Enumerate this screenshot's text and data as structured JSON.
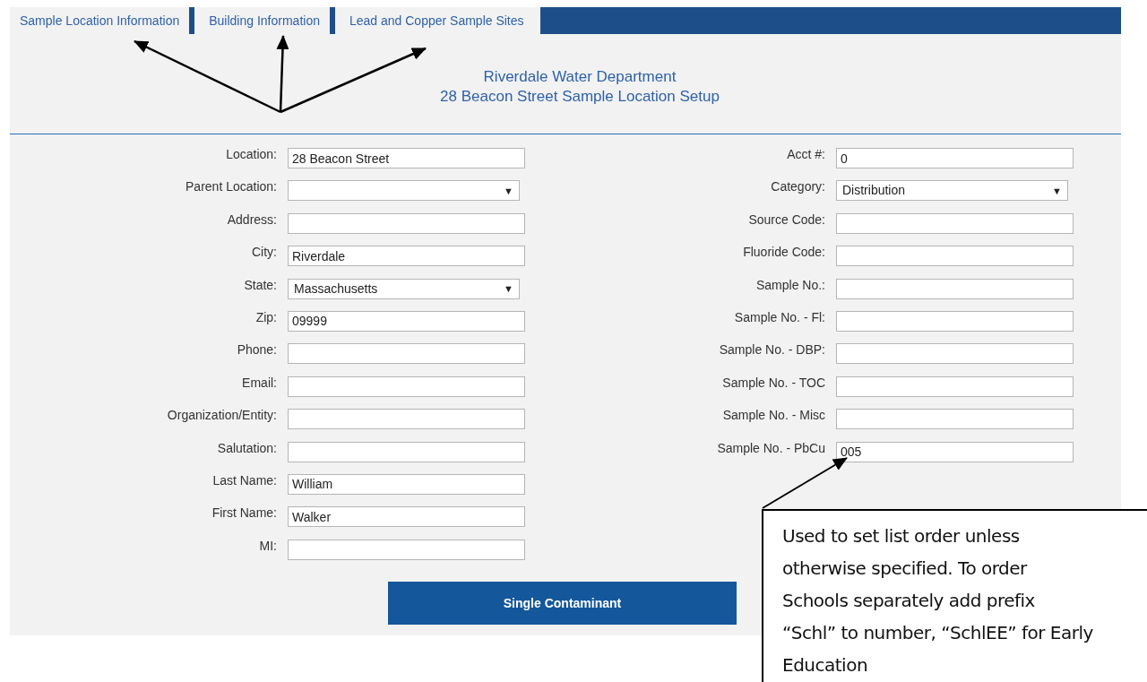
{
  "tabs": [
    {
      "label": "Sample Location Information"
    },
    {
      "label": "Building Information"
    },
    {
      "label": "Lead and Copper Sample Sites"
    }
  ],
  "header": {
    "title": "Riverdale Water Department",
    "subtitle": "28 Beacon Street Sample Location Setup"
  },
  "left_fields": [
    {
      "label": "Location:",
      "kind": "text",
      "value": "28 Beacon Street"
    },
    {
      "label": "Parent Location:",
      "kind": "select"
    },
    {
      "label": "Address:",
      "kind": "text"
    },
    {
      "label": "City:",
      "kind": "text",
      "value": "Riverdale"
    },
    {
      "label": "State:",
      "kind": "select",
      "value": "Massachusetts"
    },
    {
      "label": "Zip:",
      "kind": "text",
      "value": "09999"
    },
    {
      "label": "Phone:",
      "kind": "text"
    },
    {
      "label": "Email:",
      "kind": "text"
    },
    {
      "label": "Organization/Entity:",
      "kind": "text"
    },
    {
      "label": "Salutation:",
      "kind": "text"
    },
    {
      "label": "Last Name:",
      "kind": "text",
      "value": "William"
    },
    {
      "label": "First Name:",
      "kind": "text",
      "value": "Walker"
    },
    {
      "label": "MI:",
      "kind": "text"
    }
  ],
  "right_fields": [
    {
      "label": "Acct #:",
      "kind": "text",
      "value": "0"
    },
    {
      "label": "Category:",
      "kind": "select",
      "value": "Distribution"
    },
    {
      "label": "Source Code:",
      "kind": "text"
    },
    {
      "label": "Fluoride Code:",
      "kind": "text"
    },
    {
      "label": "Sample No.:",
      "kind": "text"
    },
    {
      "label": "Sample No. - Fl:",
      "kind": "text"
    },
    {
      "label": "Sample No. - DBP:",
      "kind": "text"
    },
    {
      "label": "Sample No. - TOC",
      "kind": "text"
    },
    {
      "label": "Sample No. - Misc",
      "kind": "text"
    },
    {
      "label": "Sample No. - PbCu",
      "kind": "text",
      "value": "005"
    }
  ],
  "select_arrow": "▼",
  "button": "Single Contaminant",
  "callout": "Used to set list order unless otherwise specified. To order Schools separately add prefix “Schl” to number, “SchlEE” for Early Education"
}
